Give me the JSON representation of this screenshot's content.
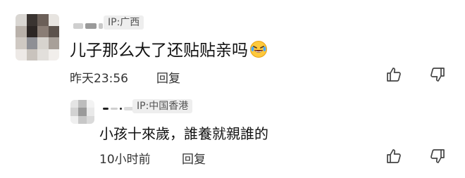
{
  "comment": {
    "avatar_icon": "pixelated-avatar",
    "ip_label": "IP:广西",
    "text": "儿子那么大了还贴贴亲吗",
    "emoji_icon": "rolling-on-floor-laughing-emoji",
    "time": "昨天23:56",
    "reply_label": "回复",
    "like_icon": "thumbs-up-icon",
    "dislike_icon": "thumbs-down-icon"
  },
  "reply": {
    "avatar_icon": "pixelated-avatar",
    "ip_label": "IP:中国香港",
    "text": "小孩十來歲，誰養就親誰的",
    "time": "10小时前",
    "reply_label": "回复",
    "like_icon": "thumbs-up-icon",
    "dislike_icon": "thumbs-down-icon"
  }
}
